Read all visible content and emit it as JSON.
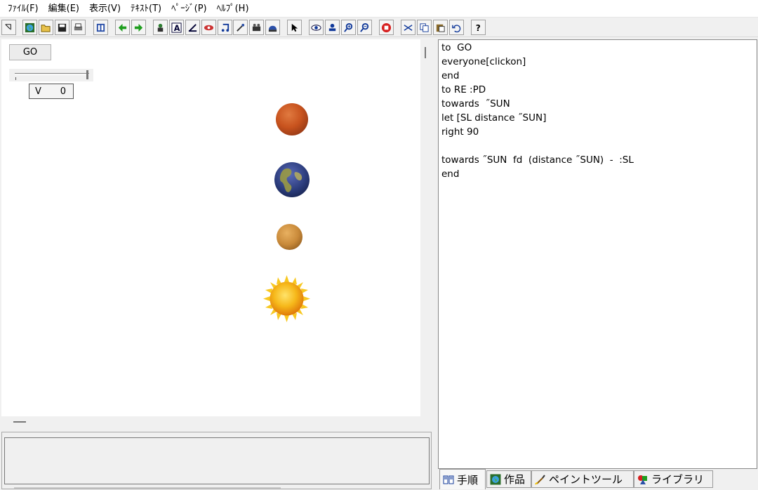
{
  "menu": {
    "file": "ﾌｧｲﾙ(F)",
    "edit": "編集(E)",
    "view": "表示(V)",
    "text": "ﾃｷｽﾄ(T)",
    "page": "ﾍﾟｰｼﾞ(P)",
    "help": "ﾍﾙﾌﾟ(H)"
  },
  "toolbar": {
    "icons": [
      "select-window-icon",
      "globe-icon",
      "open-folder-icon",
      "save-icon",
      "print-icon",
      "project-icon",
      "arrow-left-icon",
      "arrow-right-icon",
      "turtle-icon",
      "text-box-icon",
      "slider-tool-icon",
      "paint-tool-icon",
      "music-icon",
      "tools-icon",
      "camera-icon",
      "helmet-icon",
      "pointer-icon",
      "eye-icon",
      "stamp-icon",
      "zoom-in-icon",
      "zoom-out-icon",
      "stop-icon",
      "scissors-icon",
      "copy-icon",
      "paste-icon",
      "undo-icon",
      "help-icon"
    ]
  },
  "stage": {
    "go_button": "GO",
    "variable_name": "V",
    "variable_value": "0",
    "slider_value": 1.0
  },
  "editor": {
    "lines": [
      "to  GO",
      "everyone[clickon]",
      "end",
      "to RE :PD",
      "towards  ˝SUN",
      "let [SL distance ˝SUN]",
      "right 90",
      "",
      "towards ˝SUN  fd  (distance ˝SUN)  -  :SL",
      "end"
    ]
  },
  "tabs": {
    "procedures": "手順",
    "work": "作品",
    "paint_tool": "ペイントツール",
    "library": "ライブラリ"
  },
  "colors": {
    "mars": "#c8531e",
    "earth_ocean": "#2a3b7a",
    "earth_land": "#8a8a3a",
    "venus": "#c98a3a",
    "sun": "#f6b81a"
  }
}
